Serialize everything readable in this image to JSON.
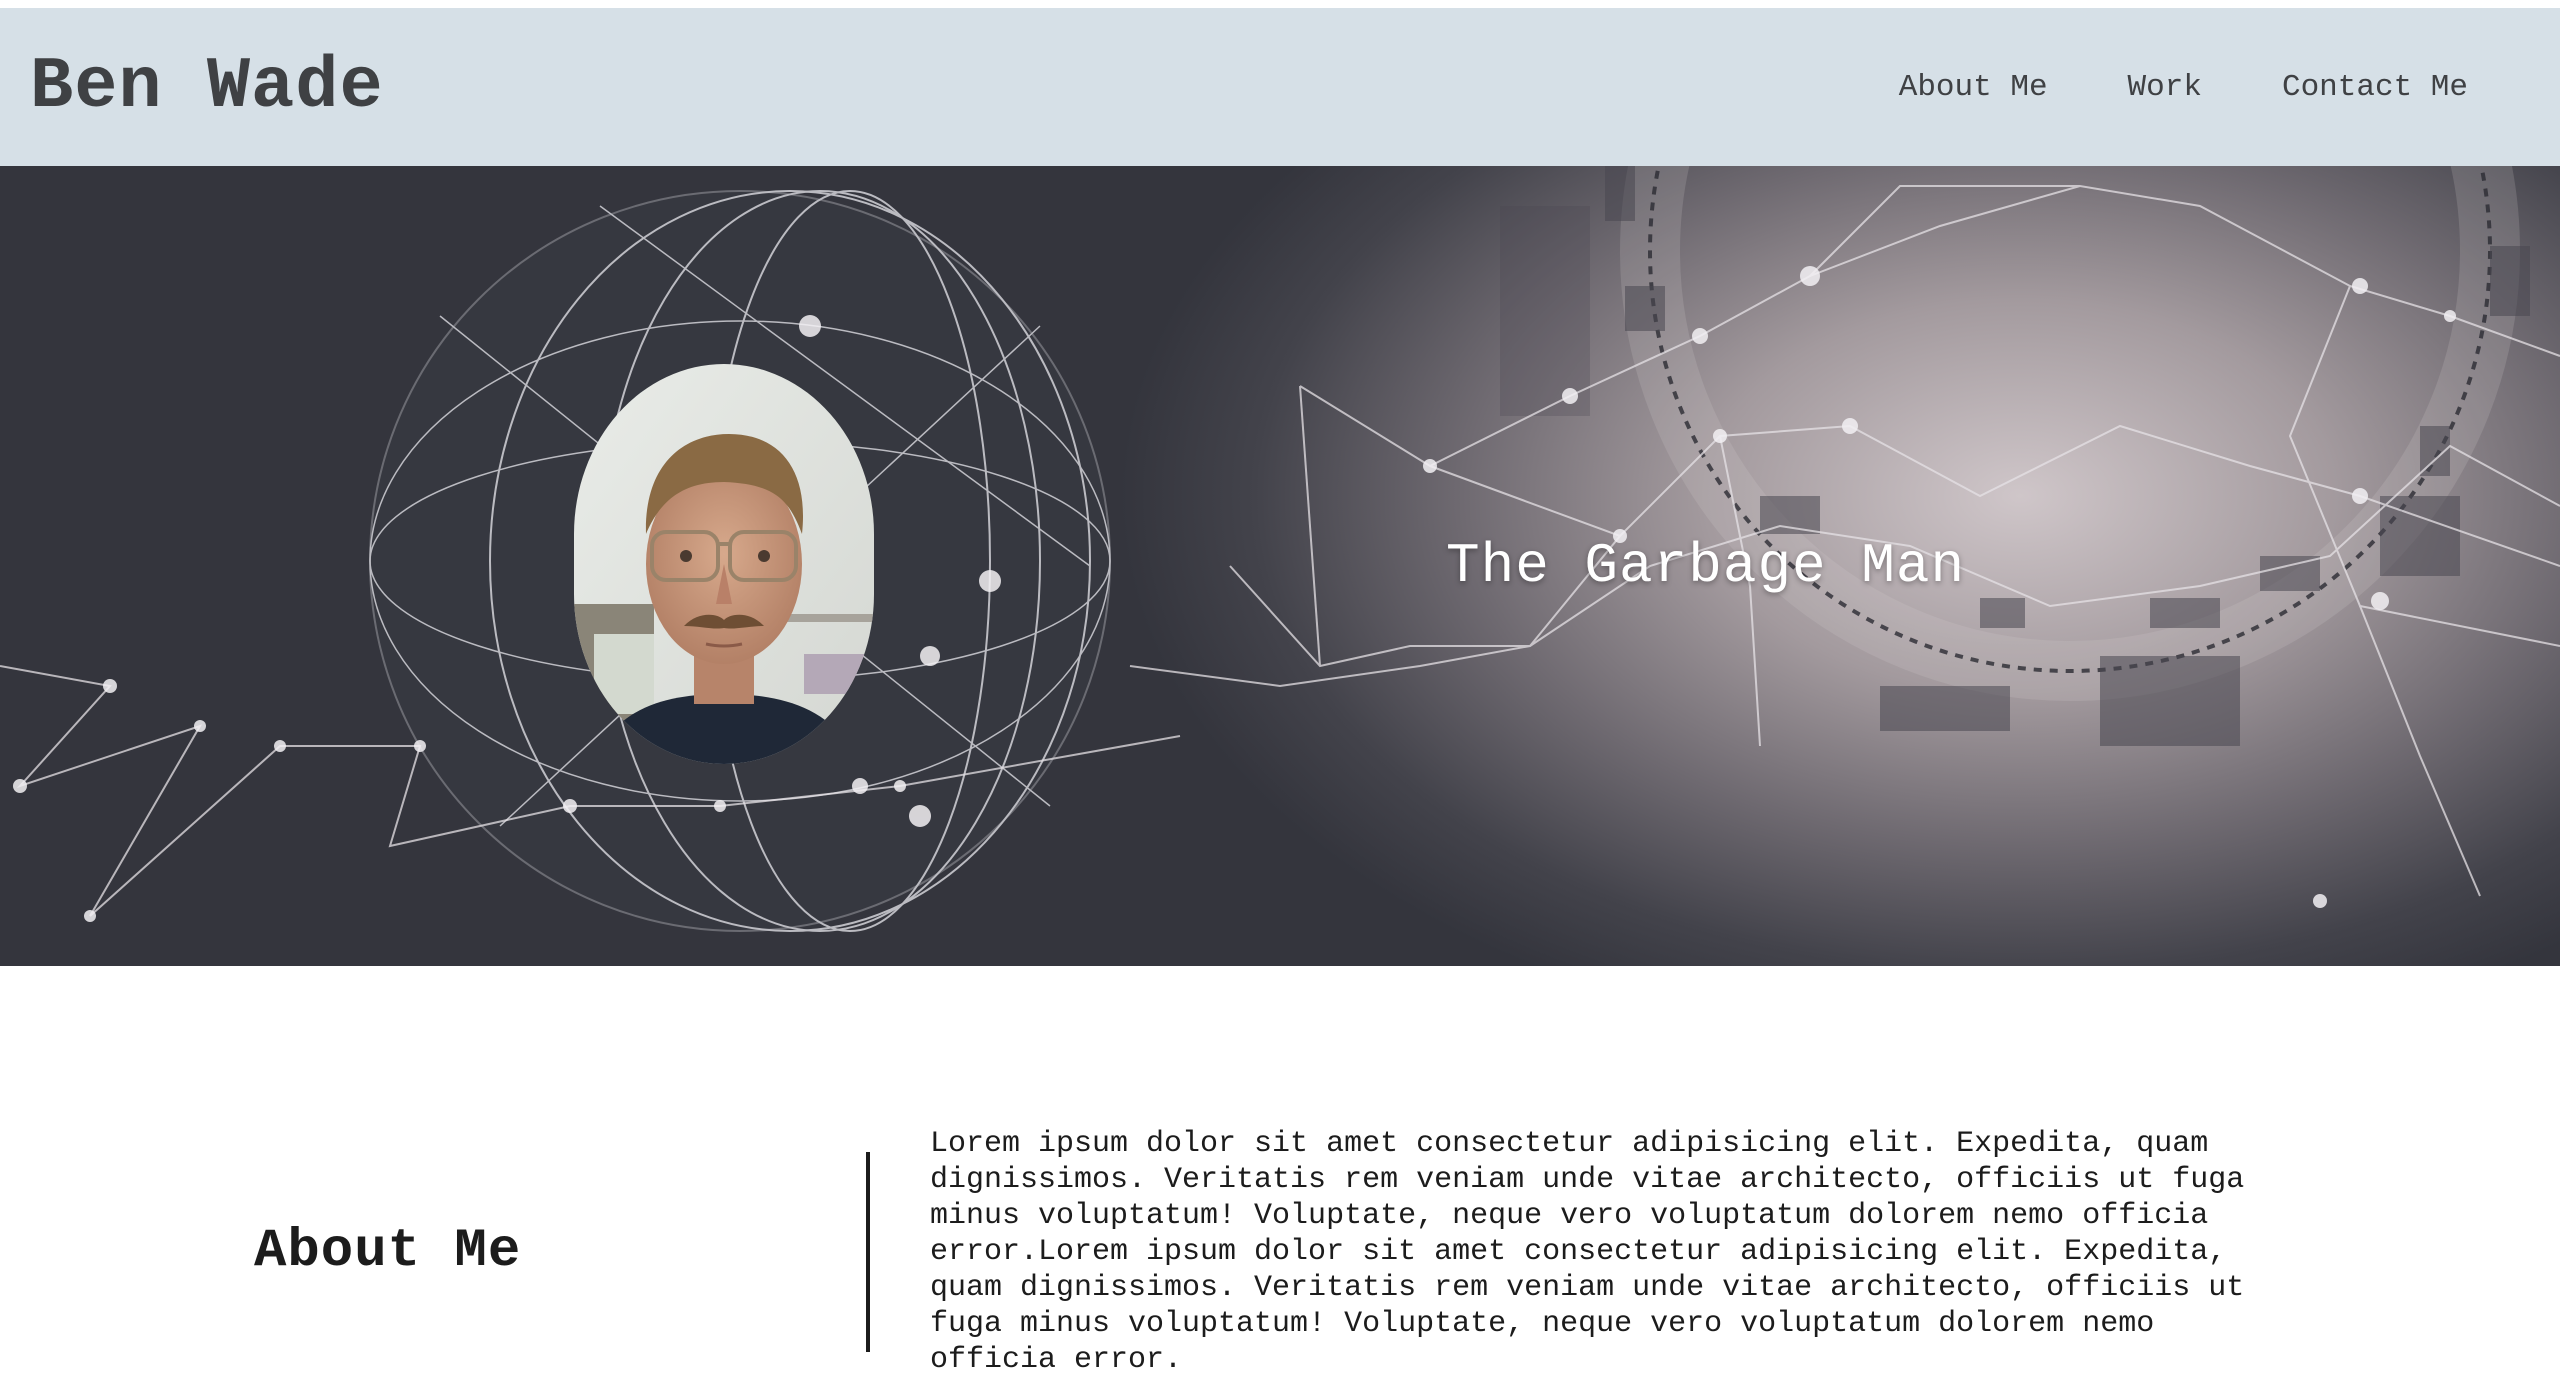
{
  "header": {
    "brand": "Ben Wade",
    "nav": [
      {
        "label": "About Me"
      },
      {
        "label": "Work"
      },
      {
        "label": "Contact Me"
      }
    ]
  },
  "hero": {
    "tagline": "The Garbage Man",
    "avatar_alt": "profile-photo"
  },
  "about": {
    "title": "About Me",
    "body": "Lorem ipsum dolor sit amet consectetur adipisicing elit. Expedita, quam dignissimos. Veritatis rem veniam unde vitae architecto, officiis ut fuga minus voluptatum! Voluptate, neque vero voluptatum dolorem nemo officia error.Lorem ipsum dolor sit amet consectetur adipisicing elit. Expedita, quam dignissimos. Veritatis rem veniam unde vitae architecto, officiis ut fuga minus voluptatum! Voluptate, neque vero voluptatum dolorem nemo officia error."
  },
  "colors": {
    "header_bg": "#d6e0e7",
    "hero_dark": "#34353d",
    "hero_light": "#cfc6c9",
    "text": "#3f4144"
  }
}
